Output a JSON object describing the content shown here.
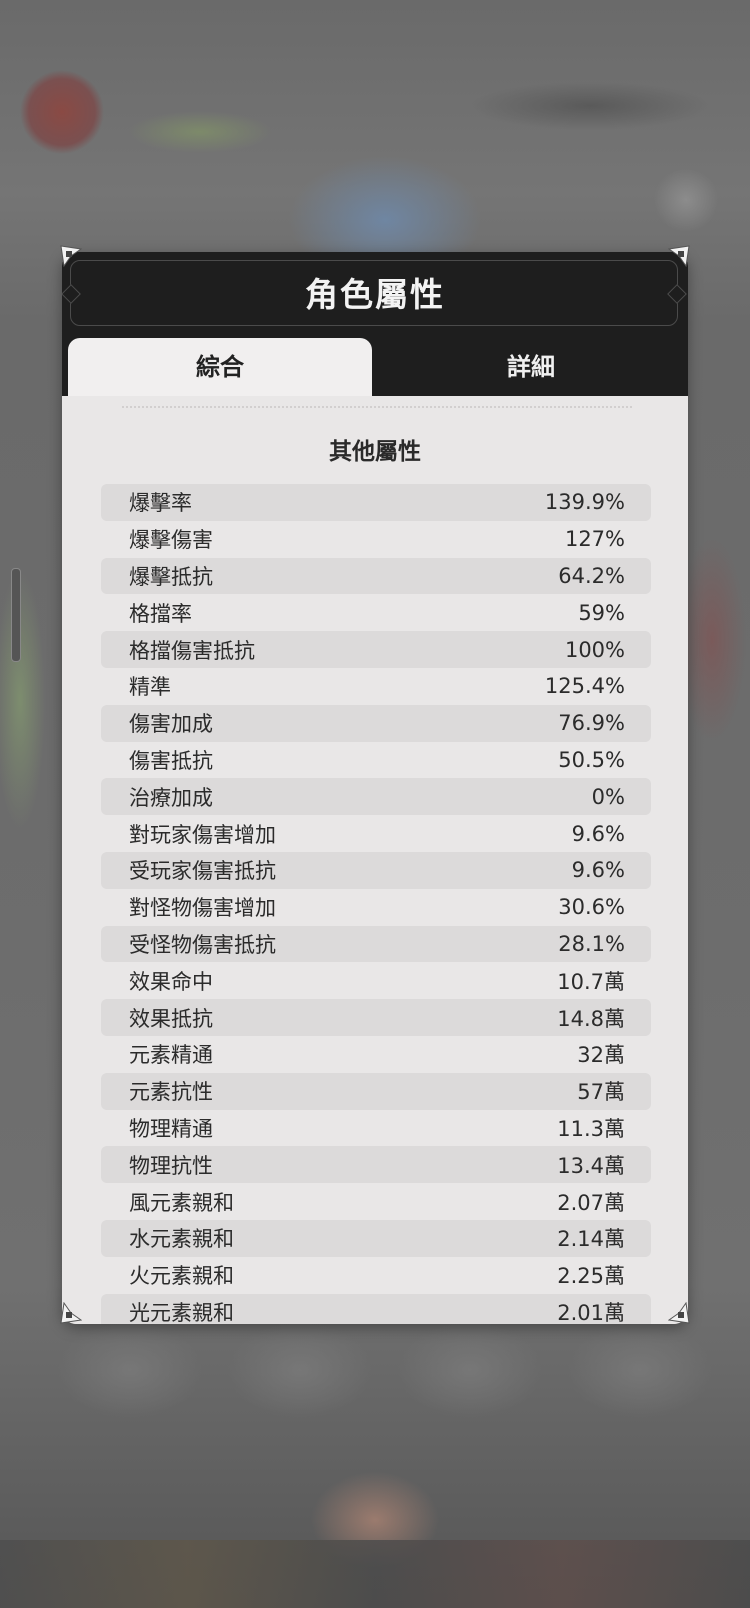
{
  "panel": {
    "title": "角色屬性",
    "tabs": [
      {
        "label": "綜合",
        "active": true
      },
      {
        "label": "詳細",
        "active": false
      }
    ],
    "section_title": "其他屬性"
  },
  "stats": [
    {
      "label": "爆擊率",
      "value": "139.9%"
    },
    {
      "label": "爆擊傷害",
      "value": "127%"
    },
    {
      "label": "爆擊抵抗",
      "value": "64.2%"
    },
    {
      "label": "格擋率",
      "value": "59%"
    },
    {
      "label": "格擋傷害抵抗",
      "value": "100%"
    },
    {
      "label": "精準",
      "value": "125.4%"
    },
    {
      "label": "傷害加成",
      "value": "76.9%"
    },
    {
      "label": "傷害抵抗",
      "value": "50.5%"
    },
    {
      "label": "治療加成",
      "value": "0%"
    },
    {
      "label": "對玩家傷害增加",
      "value": "9.6%"
    },
    {
      "label": "受玩家傷害抵抗",
      "value": "9.6%"
    },
    {
      "label": "對怪物傷害增加",
      "value": "30.6%"
    },
    {
      "label": "受怪物傷害抵抗",
      "value": "28.1%"
    },
    {
      "label": "效果命中",
      "value": "10.7萬"
    },
    {
      "label": "效果抵抗",
      "value": "14.8萬"
    },
    {
      "label": "元素精通",
      "value": "32萬"
    },
    {
      "label": "元素抗性",
      "value": "57萬"
    },
    {
      "label": "物理精通",
      "value": "11.3萬"
    },
    {
      "label": "物理抗性",
      "value": "13.4萬"
    },
    {
      "label": "風元素親和",
      "value": "2.07萬"
    },
    {
      "label": "水元素親和",
      "value": "2.14萬"
    },
    {
      "label": "火元素親和",
      "value": "2.25萬"
    },
    {
      "label": "光元素親和",
      "value": "2.01萬"
    }
  ],
  "colors": {
    "header_bg": "#1e1e1e",
    "panel_bg": "#e9e7e7",
    "row_stripe": "#dcdada",
    "text": "#2b2b2b"
  }
}
